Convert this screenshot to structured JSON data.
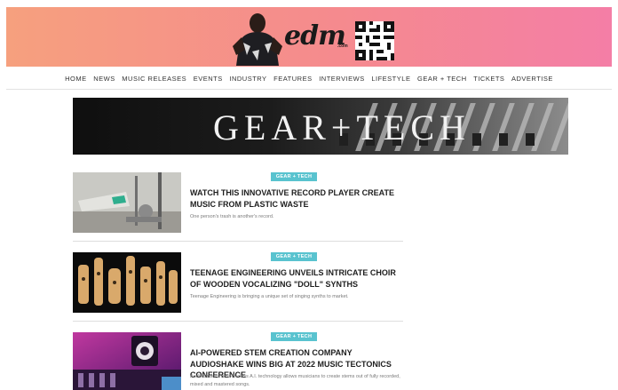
{
  "header": {
    "logo_text": "edm",
    "logo_suffix": ".com",
    "brand_color": "#f58a8e"
  },
  "nav": {
    "items": [
      "HOME",
      "NEWS",
      "MUSIC RELEASES",
      "EVENTS",
      "INDUSTRY",
      "FEATURES",
      "INTERVIEWS",
      "LIFESTYLE",
      "GEAR + TECH",
      "TICKETS",
      "ADVERTISE"
    ]
  },
  "banner": {
    "title": "GEAR+TECH"
  },
  "articles": [
    {
      "tag": "GEAR + TECH",
      "headline": "WATCH THIS INNOVATIVE RECORD PLAYER CREATE MUSIC FROM PLASTIC WASTE",
      "dek": "One person's trash is another's record."
    },
    {
      "tag": "GEAR + TECH",
      "headline": "TEENAGE ENGINEERING UNVEILS INTRICATE CHOIR OF WOODEN VOCALIZING \"DOLL\" SYNTHS",
      "dek": "Teenage Engineering is bringing a unique set of singing synths to market."
    },
    {
      "tag": "GEAR + TECH",
      "headline": "AI-POWERED STEM CREATION COMPANY AUDIOSHAKE WINS BIG AT 2022 MUSIC TECTONICS CONFERENCE",
      "dek": "AudioShake's best-in-class A.I. technology allows musicians to create stems out of fully recorded, mixed and mastered songs."
    }
  ],
  "colors": {
    "tag_bg": "#59c3cf",
    "header_gradient_start": "#f6a07e",
    "header_gradient_end": "#f47ea6"
  }
}
